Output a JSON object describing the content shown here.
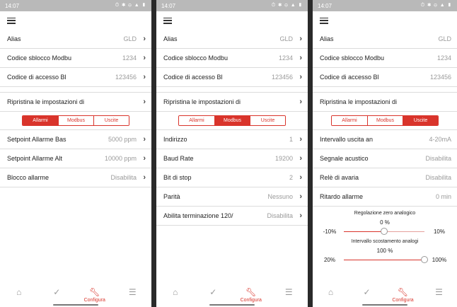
{
  "status_time": "14:07",
  "status_icons": "⏱ ✱ ⊖ ▲ ▮",
  "nav": {
    "configura": "Configura"
  },
  "common": {
    "alias": {
      "label": "Alias",
      "value": "GLD"
    },
    "codice_modbu": {
      "label": "Codice sblocco Modbu",
      "value": "1234"
    },
    "codice_accesso": {
      "label": "Codice di accesso Bl",
      "value": "123456"
    },
    "ripristina": {
      "label": "Ripristina le impostazioni di"
    }
  },
  "tabs": [
    "Allarmi",
    "Modbus",
    "Uscite"
  ],
  "screen1_rows": [
    {
      "label": "Setpoint Allarme Bas",
      "value": "5000 ppm"
    },
    {
      "label": "Setpoint Allarme Alt",
      "value": "10000 ppm"
    },
    {
      "label": "Blocco allarme",
      "value": "Disabilita"
    }
  ],
  "screen2_rows": [
    {
      "label": "Indirizzo",
      "value": "1"
    },
    {
      "label": "Baud Rate",
      "value": "19200"
    },
    {
      "label": "Bit di stop",
      "value": "2"
    },
    {
      "label": "Parità",
      "value": "Nessuno"
    },
    {
      "label": "Abilita terminazione 120/",
      "value": "Disabilita"
    }
  ],
  "screen3_rows": [
    {
      "label": "Intervallo uscita an",
      "value": "4-20mA"
    },
    {
      "label": "Segnale acustico",
      "value": "Disabilita"
    },
    {
      "label": "Relè di avaria",
      "value": "Disabilita"
    },
    {
      "label": "Ritardo allarme",
      "value": "0 min"
    }
  ],
  "slider_zero": {
    "title": "Regolazione zero analogico",
    "value": "0 %",
    "min": "-10%",
    "max": "10%",
    "level": 0.5
  },
  "slider_span": {
    "title": "Intervallo scostamento analogi",
    "value": "100 %",
    "min": "20%",
    "max": "100%",
    "level": 1.0
  },
  "colors": {
    "accent": "#d9342b",
    "statusbar": "#b9b9b9",
    "divider": "#dcdcdc"
  }
}
